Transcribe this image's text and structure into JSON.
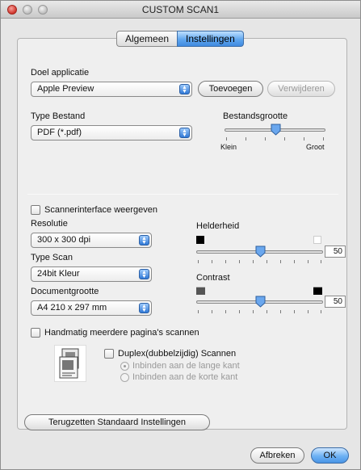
{
  "window": {
    "title": "CUSTOM SCAN1"
  },
  "tabs": [
    {
      "label": "Algemeen",
      "active": false
    },
    {
      "label": "Instellingen",
      "active": true
    }
  ],
  "target_app": {
    "label": "Doel applicatie",
    "value": "Apple Preview",
    "add_button": "Toevoegen",
    "remove_button": "Verwijderen"
  },
  "file_type": {
    "label": "Type Bestand",
    "value": "PDF (*.pdf)"
  },
  "file_size": {
    "label": "Bestandsgrootte",
    "min_label": "Klein",
    "max_label": "Groot",
    "level": 0.5
  },
  "scanner_interface": {
    "label": "Scannerinterface weergeven",
    "checked": false
  },
  "resolution": {
    "label": "Resolutie",
    "value": "300 x 300 dpi"
  },
  "scan_type": {
    "label": "Type Scan",
    "value": "24bit Kleur"
  },
  "document_size": {
    "label": "Documentgrootte",
    "value": "A4  210 x 297 mm"
  },
  "brightness": {
    "label": "Helderheid",
    "value": "50",
    "level": 0.5
  },
  "contrast": {
    "label": "Contrast",
    "value": "50",
    "level": 0.5
  },
  "multi_page": {
    "label": "Handmatig meerdere pagina's scannen",
    "checked": false
  },
  "duplex": {
    "label": "Duplex(dubbelzijdig) Scannen",
    "checked": false,
    "options": [
      "Inbinden aan de lange kant",
      "Inbinden aan de korte kant"
    ],
    "selected_index": 0
  },
  "reset_button": "Terugzetten Standaard Instellingen",
  "cancel_button": "Afbreken",
  "ok_button": "OK"
}
